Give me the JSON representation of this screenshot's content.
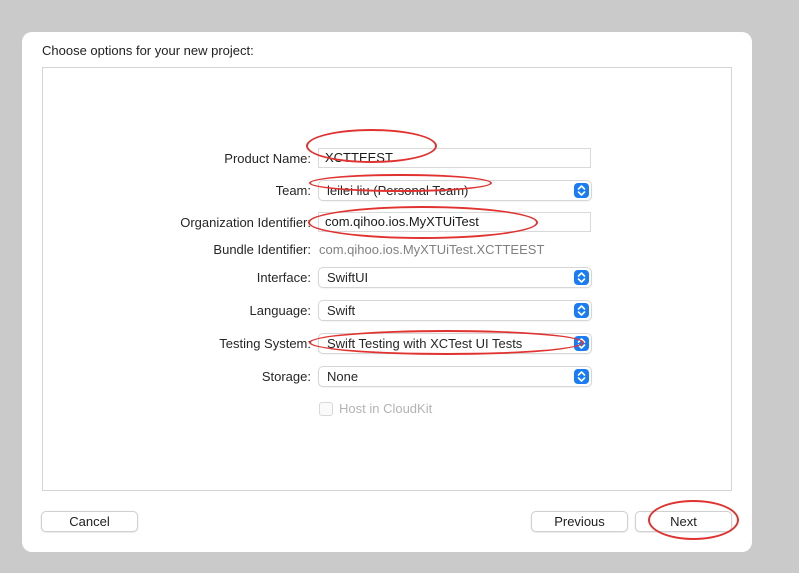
{
  "dialog": {
    "title": "Choose options for your new project:",
    "fields": {
      "product_name": {
        "label": "Product Name:",
        "value": "XCTTEEST"
      },
      "team": {
        "label": "Team:",
        "value": "leilei liu (Personal Team)"
      },
      "organization_identifier": {
        "label": "Organization Identifier:",
        "value": "com.qihoo.ios.MyXTUiTest"
      },
      "bundle_identifier": {
        "label": "Bundle Identifier:",
        "value": "com.qihoo.ios.MyXTUiTest.XCTTEEST"
      },
      "interface": {
        "label": "Interface:",
        "value": "SwiftUI"
      },
      "language": {
        "label": "Language:",
        "value": "Swift"
      },
      "testing_system": {
        "label": "Testing System:",
        "value": "Swift Testing with XCTest UI Tests"
      },
      "storage": {
        "label": "Storage:",
        "value": "None"
      }
    },
    "host_in_cloudkit": {
      "label": "Host in CloudKit",
      "checked": false,
      "enabled": false
    },
    "buttons": {
      "cancel": "Cancel",
      "previous": "Previous",
      "next": "Next"
    }
  },
  "colors": {
    "annotation_red": "#e0322f",
    "popup_blue": "#1a7cf5"
  }
}
